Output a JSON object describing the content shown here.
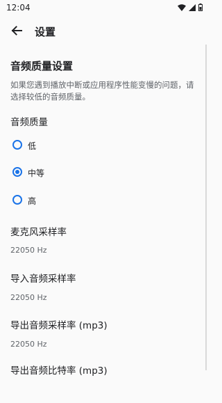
{
  "status_bar": {
    "time": "12:04",
    "icons": [
      "wifi-icon",
      "signal-icon",
      "battery-icon"
    ]
  },
  "app_bar": {
    "title": "设置",
    "back_icon": "arrow-back-icon"
  },
  "audio_quality_section": {
    "title": "音频质量设置",
    "description": "如果您遇到播放中断或应用程序性能变慢的问题，请选择较低的音频质量。"
  },
  "audio_quality": {
    "title": "音频质量",
    "options": [
      {
        "label": "低",
        "selected": false
      },
      {
        "label": "中等",
        "selected": true
      },
      {
        "label": "高",
        "selected": false
      }
    ]
  },
  "preferences": [
    {
      "title": "麦克风采样率",
      "value": "22050 Hz"
    },
    {
      "title": "导入音频采样率",
      "value": "22050 Hz"
    },
    {
      "title": "导出音频采样率 (mp3)",
      "value": "22050 Hz"
    },
    {
      "title": "导出音频比特率 (mp3)",
      "value": ""
    }
  ],
  "colors": {
    "accent": "#1a73e8",
    "background": "#fafafa",
    "text_primary": "#202124",
    "text_secondary": "#5f6368"
  }
}
